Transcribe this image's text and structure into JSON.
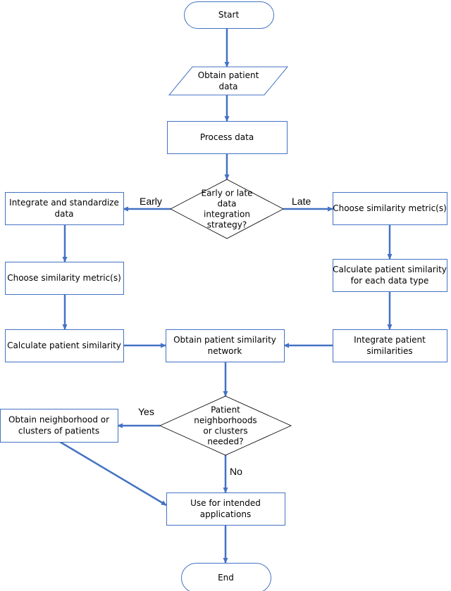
{
  "diagram": {
    "type": "flowchart",
    "colors": {
      "node_border": "#4472c4",
      "decision_border": "#000000",
      "arrow": "#4472c4",
      "fill": "#ffffff",
      "text": "#000000"
    },
    "nodes": {
      "start": {
        "shape": "terminator",
        "lines": [
          "Start"
        ]
      },
      "obtain_data": {
        "shape": "parallelogram",
        "lines": [
          "Obtain patient",
          "data"
        ]
      },
      "process_data": {
        "shape": "process",
        "lines": [
          "Process data"
        ]
      },
      "strategy": {
        "shape": "decision",
        "lines": [
          "Early or late",
          "data",
          "integration",
          "strategy?"
        ]
      },
      "integrate_std": {
        "shape": "process",
        "lines": [
          "Integrate and standardize",
          "data"
        ]
      },
      "choose_left": {
        "shape": "process",
        "lines": [
          "Choose similarity metric(s)"
        ]
      },
      "calc_left": {
        "shape": "process",
        "lines": [
          "Calculate patient similarity"
        ]
      },
      "choose_right": {
        "shape": "process",
        "lines": [
          "Choose similarity metric(s)"
        ]
      },
      "calc_right": {
        "shape": "process",
        "lines": [
          "Calculate patient similarity",
          "for each data type"
        ]
      },
      "integrate_sim": {
        "shape": "process",
        "lines": [
          "Integrate patient",
          "similarities"
        ]
      },
      "network": {
        "shape": "process",
        "lines": [
          "Obtain patient similarity",
          "network"
        ]
      },
      "needed": {
        "shape": "decision",
        "lines": [
          "Patient",
          "neighborhoods",
          "or clusters",
          "needed?"
        ]
      },
      "clusters": {
        "shape": "process",
        "lines": [
          "Obtain neighborhood or",
          "clusters of patients"
        ]
      },
      "use": {
        "shape": "process",
        "lines": [
          "Use for intended",
          "applications"
        ]
      },
      "end": {
        "shape": "terminator",
        "lines": [
          "End"
        ]
      }
    },
    "edges": [
      {
        "from": "start",
        "to": "obtain_data",
        "label": ""
      },
      {
        "from": "obtain_data",
        "to": "process_data",
        "label": ""
      },
      {
        "from": "process_data",
        "to": "strategy",
        "label": ""
      },
      {
        "from": "strategy",
        "to": "integrate_std",
        "label": "Early"
      },
      {
        "from": "strategy",
        "to": "choose_right",
        "label": "Late"
      },
      {
        "from": "integrate_std",
        "to": "choose_left",
        "label": ""
      },
      {
        "from": "choose_left",
        "to": "calc_left",
        "label": ""
      },
      {
        "from": "choose_right",
        "to": "calc_right",
        "label": ""
      },
      {
        "from": "calc_right",
        "to": "integrate_sim",
        "label": ""
      },
      {
        "from": "calc_left",
        "to": "network",
        "label": ""
      },
      {
        "from": "integrate_sim",
        "to": "network",
        "label": ""
      },
      {
        "from": "network",
        "to": "needed",
        "label": ""
      },
      {
        "from": "needed",
        "to": "clusters",
        "label": "Yes"
      },
      {
        "from": "needed",
        "to": "use",
        "label": "No"
      },
      {
        "from": "clusters",
        "to": "use",
        "label": ""
      },
      {
        "from": "use",
        "to": "end",
        "label": ""
      }
    ]
  }
}
